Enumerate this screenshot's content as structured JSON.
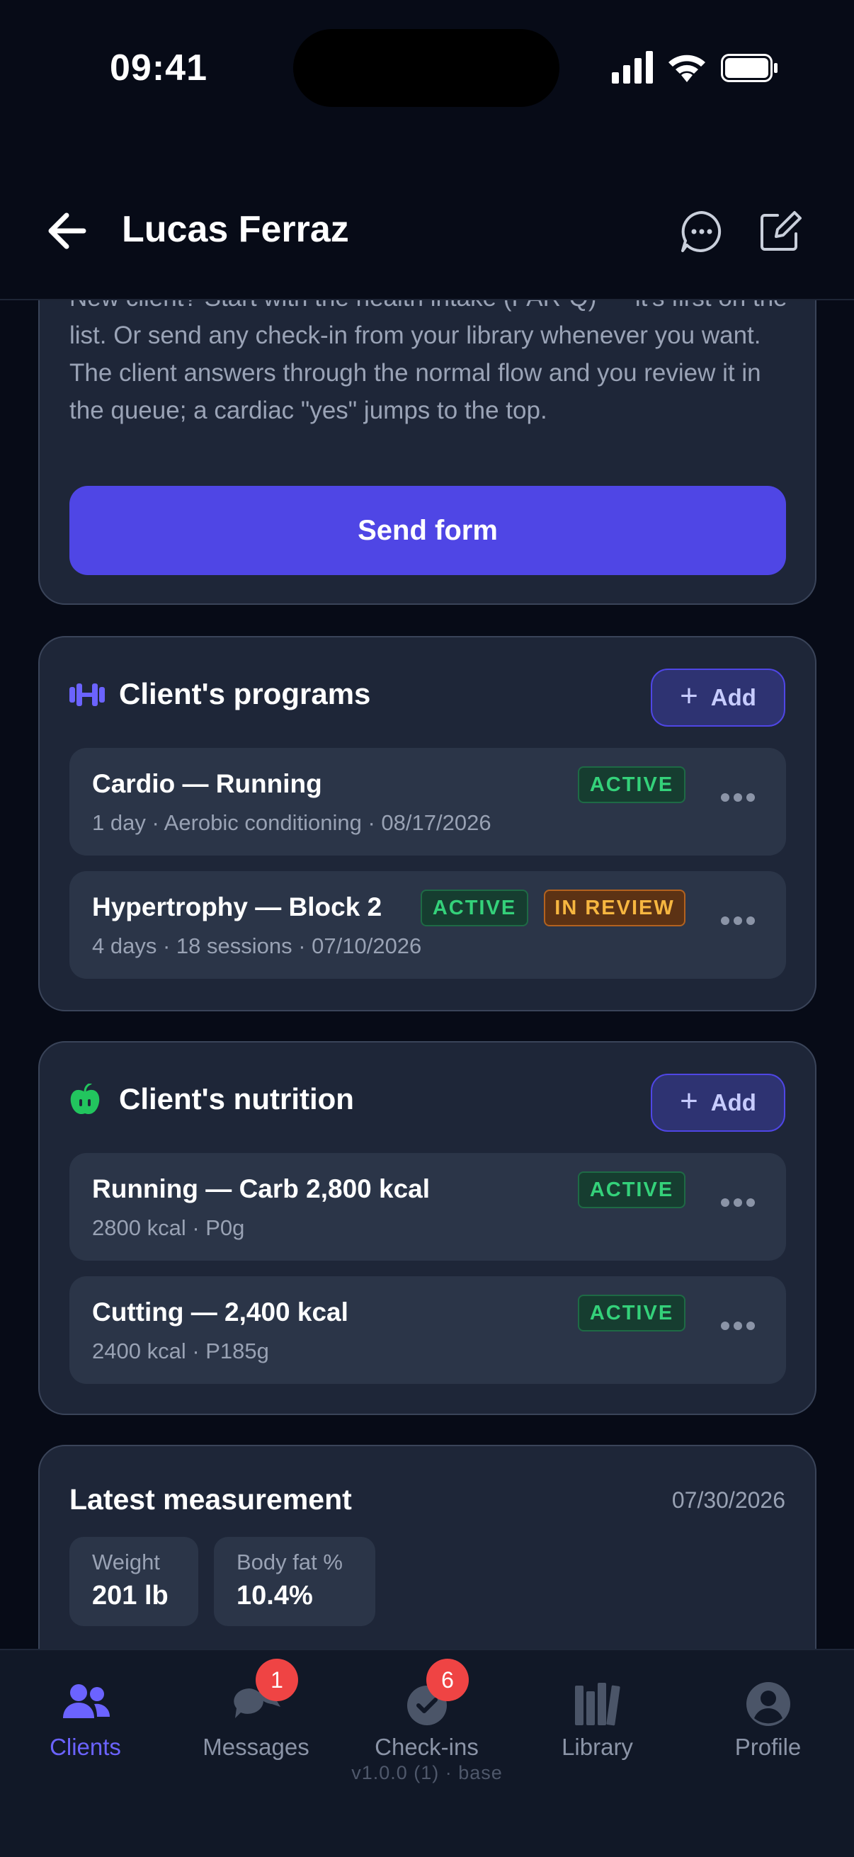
{
  "status_bar": {
    "time": "09:41"
  },
  "header": {
    "title": "Lucas Ferraz"
  },
  "intro_card": {
    "text": "New client? Start with the health intake (PAR-Q) — it's first on the list. Or send any check-in from your library whenever you want. The client answers through the normal flow and you review it in the queue; a cardiac \"yes\" jumps to the top.",
    "button_label": "Send form"
  },
  "programs": {
    "title": "Client's programs",
    "add_label": "Add",
    "items": [
      {
        "title": "Cardio — Running",
        "subtitle": "1 day · Aerobic conditioning · 08/17/2026",
        "badges": [
          "ACTIVE"
        ]
      },
      {
        "title": "Hypertrophy — Block 2",
        "subtitle": "4 days · 18 sessions · 07/10/2026",
        "badges": [
          "ACTIVE",
          "IN REVIEW"
        ]
      }
    ]
  },
  "nutrition": {
    "title": "Client's nutrition",
    "add_label": "Add",
    "items": [
      {
        "title": "Running — Carb 2,800 kcal",
        "subtitle": "2800 kcal · P0g",
        "badges": [
          "ACTIVE"
        ]
      },
      {
        "title": "Cutting — 2,400 kcal",
        "subtitle": "2400 kcal · P185g",
        "badges": [
          "ACTIVE"
        ]
      }
    ]
  },
  "measurement": {
    "title": "Latest measurement",
    "date": "07/30/2026",
    "metrics": [
      {
        "label": "Weight",
        "value": "201 lb"
      },
      {
        "label": "Body fat %",
        "value": "10.4%"
      }
    ]
  },
  "tab_bar": {
    "tabs": [
      {
        "label": "Clients",
        "icon": "users-icon",
        "active": true
      },
      {
        "label": "Messages",
        "icon": "chat-bubbles-icon",
        "badge": "1"
      },
      {
        "label": "Check-ins",
        "icon": "check-circle-icon",
        "badge": "6"
      },
      {
        "label": "Library",
        "icon": "books-icon"
      },
      {
        "label": "Profile",
        "icon": "user-circle-icon"
      }
    ],
    "version": "v1.0.0 (1) · base"
  },
  "colors": {
    "background": "#070b17",
    "card": "#1e2638",
    "item": "#2b3548",
    "accent": "#4f46e5",
    "active_green": "#34d17a",
    "review_amber": "#f6b640",
    "badge_red": "#ef4444"
  }
}
